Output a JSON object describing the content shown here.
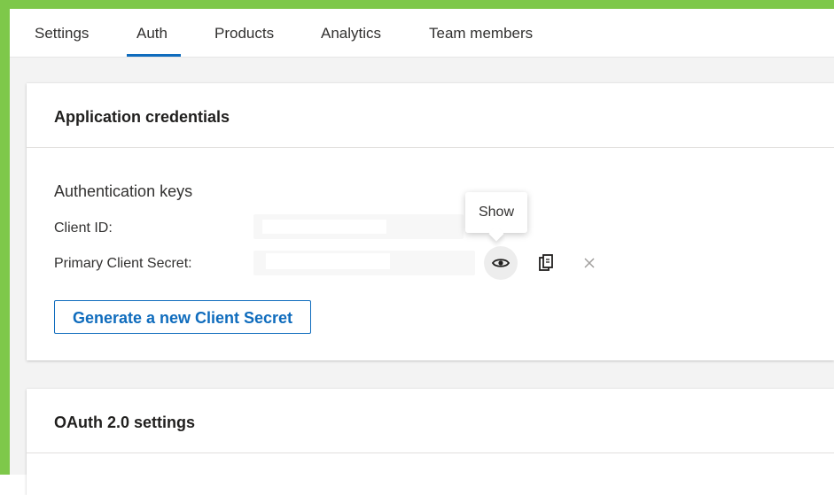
{
  "tabs": [
    {
      "label": "Settings"
    },
    {
      "label": "Auth"
    },
    {
      "label": "Products"
    },
    {
      "label": "Analytics"
    },
    {
      "label": "Team members"
    }
  ],
  "active_tab": "Auth",
  "credentials_card": {
    "title": "Application credentials",
    "section_label": "Authentication keys",
    "client_id_label": "Client ID:",
    "client_secret_label": "Primary Client Secret:",
    "tooltip": "Show",
    "generate_button": "Generate a new Client Secret",
    "icons": [
      "eye-icon",
      "copy-icon",
      "close-icon"
    ]
  },
  "oauth_card": {
    "title": "OAuth 2.0 settings"
  },
  "colors": {
    "accent": "#0f6cbd",
    "frame": "#7ec84a"
  }
}
